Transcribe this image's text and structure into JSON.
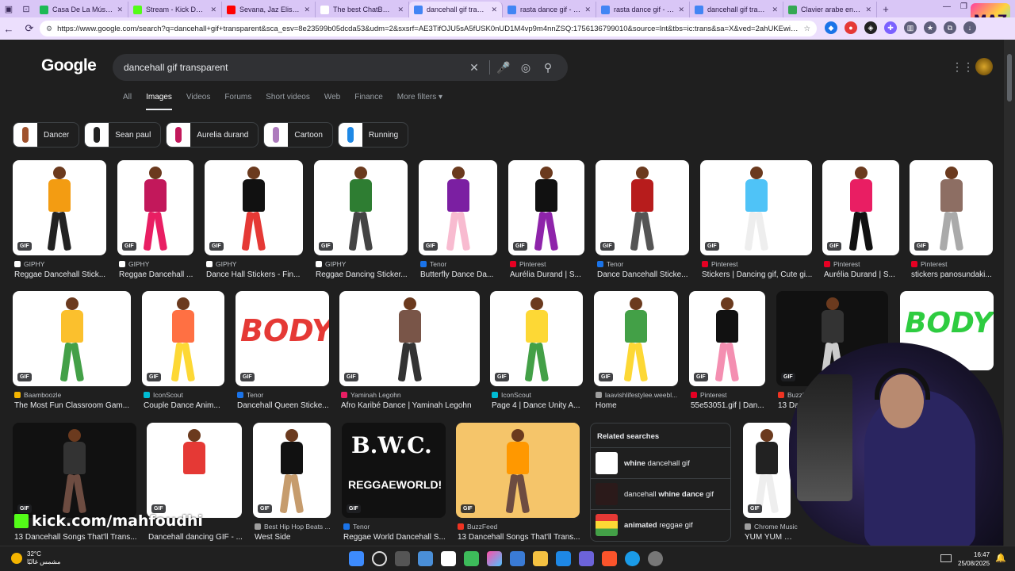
{
  "browser": {
    "tabs": [
      {
        "title": "Casa De La Música",
        "color": "#1db954"
      },
      {
        "title": "Stream - Kick Dashboard",
        "color": "#53fc18"
      },
      {
        "title": "Sevana, Jaz Elise, Lila Iké",
        "color": "#ff0000"
      },
      {
        "title": "The best ChatBot and",
        "color": "#ffffff"
      },
      {
        "title": "dancehall gif transparent",
        "color": "#4285f4"
      },
      {
        "title": "rasta dance gif - Google",
        "color": "#4285f4"
      },
      {
        "title": "rasta dance gif - Google",
        "color": "#4285f4"
      },
      {
        "title": "dancehall gif transparent",
        "color": "#4285f4"
      },
      {
        "title": "Clavier arabe en ligne",
        "color": "#34a853"
      }
    ],
    "url": "https://www.google.com/search?q=dancehall+gif+transparent&sca_esv=8e23599b05dcda53&udm=2&sxsrf=AE3TifOJU5sA5fUSK0nUD1M4vp9m4nnZSQ:1756136799010&source=lnt&tbs=ic:trans&sa=X&ved=2ahUKEwiO3t...",
    "overlay_logo": "MAZ"
  },
  "search": {
    "logo": "Google",
    "query": "dancehall gif transparent",
    "filters": [
      "All",
      "Images",
      "Videos",
      "Forums",
      "Short videos",
      "Web",
      "Finance",
      "More filters ▾"
    ],
    "chips": [
      "Dancer",
      "Sean paul",
      "Aurelia durand",
      "Cartoon",
      "Running"
    ]
  },
  "results": {
    "gif_badge": "GIF",
    "row1": [
      {
        "source": "GIPHY",
        "title": "Reggae Dancehall Stick...",
        "icolor": "#ffffff"
      },
      {
        "source": "GIPHY",
        "title": "Reggae Dancehall ...",
        "icolor": "#ffffff"
      },
      {
        "source": "GIPHY",
        "title": "Dance Hall Stickers - Fin...",
        "icolor": "#ffffff"
      },
      {
        "source": "GIPHY",
        "title": "Reggae Dancing Sticker...",
        "icolor": "#ffffff"
      },
      {
        "source": "Tenor",
        "title": "Butterfly Dance Da...",
        "icolor": "#1a73e8"
      },
      {
        "source": "Pinterest",
        "title": "Aurélia Durand | S...",
        "icolor": "#e60023"
      },
      {
        "source": "Tenor",
        "title": "Dance Dancehall Sticke...",
        "icolor": "#1a73e8"
      },
      {
        "source": "Pinterest",
        "title": "Stickers | Dancing gif, Cute gi...",
        "icolor": "#e60023"
      },
      {
        "source": "Pinterest",
        "title": "Aurélia Durand | S...",
        "icolor": "#e60023"
      },
      {
        "source": "Pinterest",
        "title": "stickers panosundaki...",
        "icolor": "#e60023"
      }
    ],
    "row2": [
      {
        "source": "Baamboozle",
        "title": "The Most Fun Classroom Gam...",
        "icolor": "#f4b400"
      },
      {
        "source": "IconScout",
        "title": "Couple Dance Anim...",
        "icolor": "#00bcd4"
      },
      {
        "source": "Tenor",
        "title": "Dancehall Queen Sticke...",
        "icolor": "#1a73e8"
      },
      {
        "source": "Yaminah Legohn",
        "title": "Afro Karibé Dance | Yaminah Legohn",
        "icolor": "#e91e63"
      },
      {
        "source": "IconScout",
        "title": "Page 4 | Dance Unity A...",
        "icolor": "#00bcd4"
      },
      {
        "source": "laavishlifestylee.weebl...",
        "title": "Home",
        "icolor": "#9e9e9e"
      },
      {
        "source": "Pinterest",
        "title": "55e53051.gif | Dan...",
        "icolor": "#e60023"
      },
      {
        "source": "BuzzFeed",
        "title": "13 Da...",
        "icolor": "#ee3322"
      }
    ],
    "row3": [
      {
        "source": "",
        "title": "13 Dancehall Songs That'll Trans...",
        "icolor": "#9e9e9e"
      },
      {
        "source": "",
        "title": "Dancehall dancing GIF - ...",
        "icolor": "#9e9e9e"
      },
      {
        "source": "Best Hip Hop Beats ...",
        "title": "West Side",
        "icolor": "#9e9e9e"
      },
      {
        "source": "Tenor",
        "title": "Reggae World Dancehall S...",
        "icolor": "#1a73e8"
      },
      {
        "source": "BuzzFeed",
        "title": "13 Dancehall Songs That'll Trans...",
        "icolor": "#ee3322"
      },
      {
        "source": "Chrome Music",
        "title": "YUM YUM Dancehall ...",
        "icolor": "#9e9e9e"
      }
    ],
    "image_text": {
      "body": "BODY",
      "bwc_top": "B.W.C.",
      "bwc_bottom": "REGGAEWORLD!"
    }
  },
  "related": {
    "heading": "Related searches",
    "items": [
      {
        "bold": "whine",
        "rest": " dancehall gif",
        "bold_first": true
      },
      {
        "pre": "dancehall ",
        "bold": "whine dance",
        "rest": " gif",
        "bold_first": false
      },
      {
        "bold": "animated",
        "rest": " reggae gif",
        "bold_first": true,
        "bold2": ""
      }
    ]
  },
  "overlay": {
    "watermark": "kick.com/mahfoudhi"
  },
  "taskbar": {
    "temp": "32°C",
    "weather": "مشمس غالبًا",
    "time": "16:47",
    "date": "25/08/2025"
  }
}
